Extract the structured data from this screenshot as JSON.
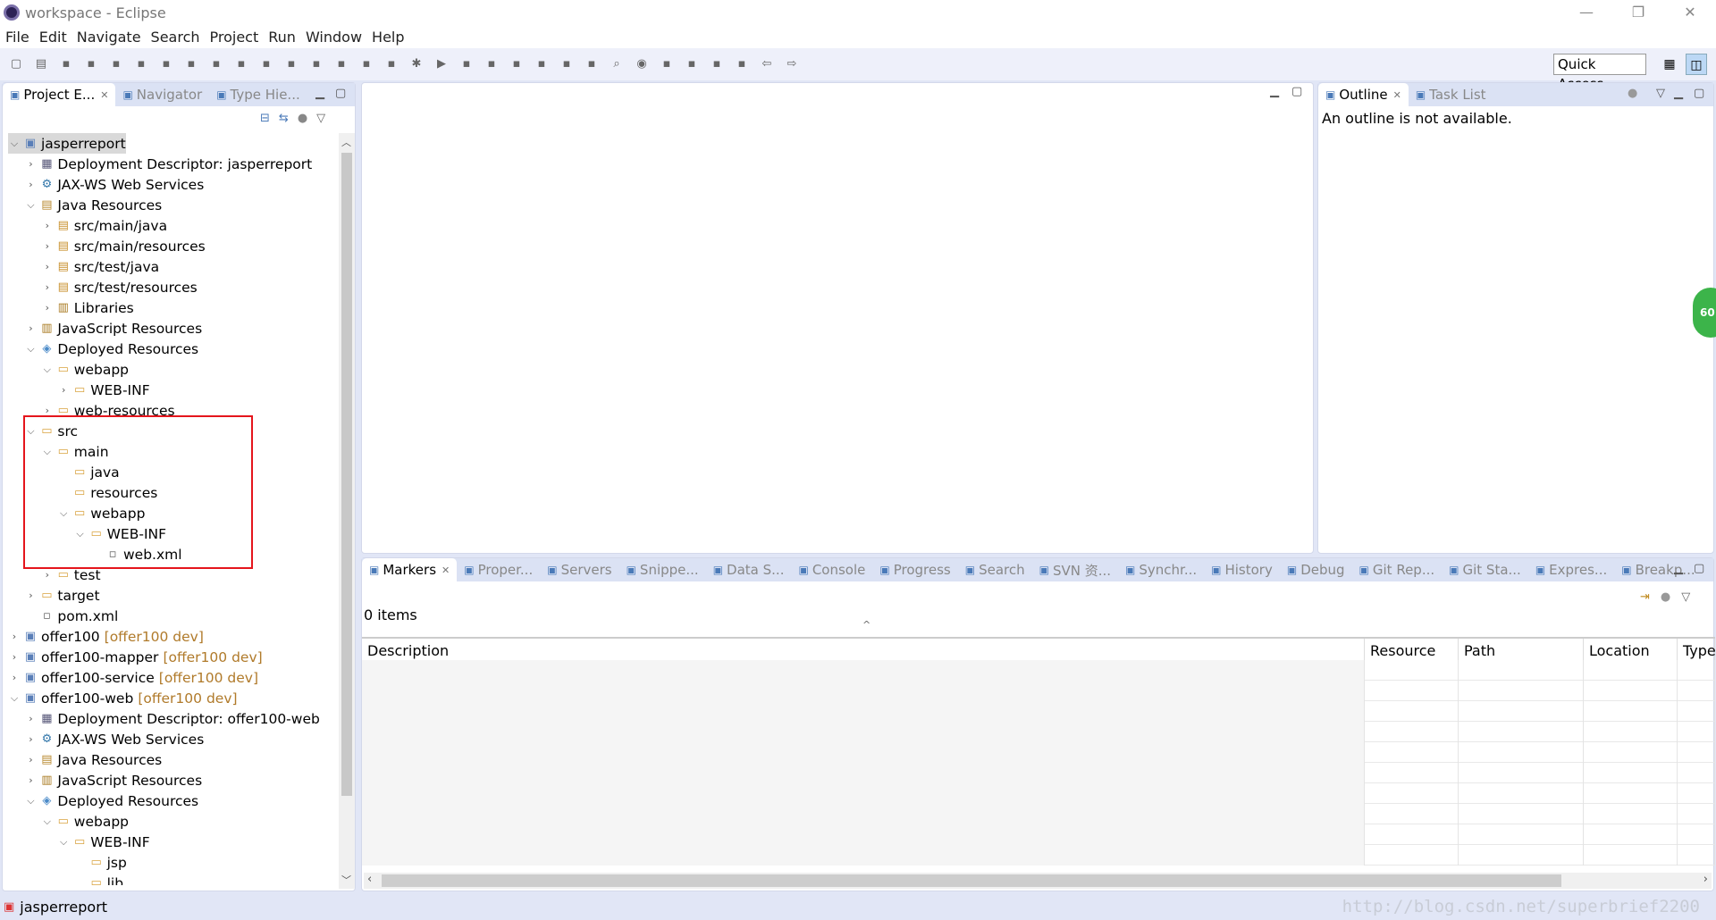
{
  "window": {
    "title": "workspace - Eclipse",
    "minimize": "—",
    "restore": "❐",
    "close": "✕"
  },
  "menu": [
    "File",
    "Edit",
    "Navigate",
    "Search",
    "Project",
    "Run",
    "Window",
    "Help"
  ],
  "toolbar": {
    "icons": [
      "new-icon",
      "save-icon",
      "save-all-icon",
      "terminal-icon",
      "skip-breakpoints-icon",
      "resume-icon",
      "suspend-icon",
      "terminate-icon",
      "disconnect-icon",
      "step-into-icon",
      "step-over-icon",
      "step-return-icon",
      "drop-to-frame-icon",
      "use-step-filters-icon",
      "wiki-icon",
      "font-icon",
      "debug-icon",
      "run-icon",
      "run-coverage-icon",
      "external-tools-icon",
      "new-server-icon",
      "new-jsp-icon",
      "open-type-icon",
      "open-task-icon",
      "search-icon",
      "globe-icon",
      "annotation-icon",
      "next-annotation-icon",
      "previous-annotation-icon",
      "last-edit-icon",
      "back-icon",
      "forward-icon"
    ],
    "quick_access": "Quick Access"
  },
  "left_panel": {
    "tabs": [
      {
        "label": "Project E...",
        "active": true
      },
      {
        "label": "Navigator"
      },
      {
        "label": "Type Hie..."
      }
    ],
    "tree": [
      {
        "d": 0,
        "e": "open",
        "label": "jasperreport",
        "icon": "project",
        "selected": true
      },
      {
        "d": 1,
        "e": "closed",
        "label": "Deployment Descriptor: jasperreport",
        "icon": "descriptor"
      },
      {
        "d": 1,
        "e": "closed",
        "label": "JAX-WS Web Services",
        "icon": "webservice"
      },
      {
        "d": 1,
        "e": "open",
        "label": "Java Resources",
        "icon": "javares"
      },
      {
        "d": 2,
        "e": "closed",
        "label": "src/main/java",
        "icon": "package"
      },
      {
        "d": 2,
        "e": "closed",
        "label": "src/main/resources",
        "icon": "package"
      },
      {
        "d": 2,
        "e": "closed",
        "label": "src/test/java",
        "icon": "package"
      },
      {
        "d": 2,
        "e": "closed",
        "label": "src/test/resources",
        "icon": "package"
      },
      {
        "d": 2,
        "e": "closed",
        "label": "Libraries",
        "icon": "library"
      },
      {
        "d": 1,
        "e": "closed",
        "label": "JavaScript Resources",
        "icon": "library"
      },
      {
        "d": 1,
        "e": "open",
        "label": "Deployed Resources",
        "icon": "deployed"
      },
      {
        "d": 2,
        "e": "open",
        "label": "webapp",
        "icon": "folder"
      },
      {
        "d": 3,
        "e": "closed",
        "label": "WEB-INF",
        "icon": "folder"
      },
      {
        "d": 2,
        "e": "closed",
        "label": "web-resources",
        "icon": "folder"
      },
      {
        "d": 1,
        "e": "open",
        "label": "src",
        "icon": "folder"
      },
      {
        "d": 2,
        "e": "open",
        "label": "main",
        "icon": "folder"
      },
      {
        "d": 3,
        "e": "",
        "label": "java",
        "icon": "folder"
      },
      {
        "d": 3,
        "e": "",
        "label": "resources",
        "icon": "folder"
      },
      {
        "d": 3,
        "e": "open",
        "label": "webapp",
        "icon": "folder"
      },
      {
        "d": 4,
        "e": "open",
        "label": "WEB-INF",
        "icon": "folder"
      },
      {
        "d": 5,
        "e": "",
        "label": "web.xml",
        "icon": "xml"
      },
      {
        "d": 2,
        "e": "closed",
        "label": "test",
        "icon": "folder"
      },
      {
        "d": 1,
        "e": "closed",
        "label": "target",
        "icon": "folder"
      },
      {
        "d": 1,
        "e": "",
        "label": "pom.xml",
        "icon": "xml"
      },
      {
        "d": 0,
        "e": "closed",
        "label": "offer100",
        "deco": "[offer100 dev]",
        "icon": "project"
      },
      {
        "d": 0,
        "e": "closed",
        "label": "offer100-mapper",
        "deco": "[offer100 dev]",
        "icon": "project"
      },
      {
        "d": 0,
        "e": "closed",
        "label": "offer100-service",
        "deco": "[offer100 dev]",
        "icon": "project"
      },
      {
        "d": 0,
        "e": "open",
        "label": "offer100-web",
        "deco": "[offer100 dev]",
        "icon": "project"
      },
      {
        "d": 1,
        "e": "closed",
        "label": "Deployment Descriptor: offer100-web",
        "icon": "descriptor"
      },
      {
        "d": 1,
        "e": "closed",
        "label": "JAX-WS Web Services",
        "icon": "webservice"
      },
      {
        "d": 1,
        "e": "closed",
        "label": "Java Resources",
        "icon": "javares"
      },
      {
        "d": 1,
        "e": "closed",
        "label": "JavaScript Resources",
        "icon": "library"
      },
      {
        "d": 1,
        "e": "open",
        "label": "Deployed Resources",
        "icon": "deployed"
      },
      {
        "d": 2,
        "e": "open",
        "label": "webapp",
        "icon": "folder"
      },
      {
        "d": 3,
        "e": "open",
        "label": "WEB-INF",
        "icon": "folder"
      },
      {
        "d": 4,
        "e": "",
        "label": "jsp",
        "icon": "folder"
      },
      {
        "d": 4,
        "e": "",
        "label": "lib",
        "icon": "folder"
      }
    ]
  },
  "outline": {
    "tabs": [
      {
        "label": "Outline",
        "active": true
      },
      {
        "label": "Task List"
      }
    ],
    "message": "An outline is not available."
  },
  "bottom": {
    "tabs": [
      {
        "label": "Markers",
        "active": true
      },
      {
        "label": "Proper..."
      },
      {
        "label": "Servers"
      },
      {
        "label": "Snippe..."
      },
      {
        "label": "Data S..."
      },
      {
        "label": "Console"
      },
      {
        "label": "Progress"
      },
      {
        "label": "Search"
      },
      {
        "label": "SVN 资..."
      },
      {
        "label": "Synchr..."
      },
      {
        "label": "History"
      },
      {
        "label": "Debug"
      },
      {
        "label": "Git Rep..."
      },
      {
        "label": "Git Sta..."
      },
      {
        "label": "Expres..."
      },
      {
        "label": "Breakp..."
      }
    ],
    "count": "0 items",
    "columns": [
      "Description",
      "Resource",
      "Path",
      "Location",
      "Type"
    ]
  },
  "status": {
    "selection": "jasperreport"
  },
  "watermark": "http://blog.csdn.net/superbrief2200"
}
